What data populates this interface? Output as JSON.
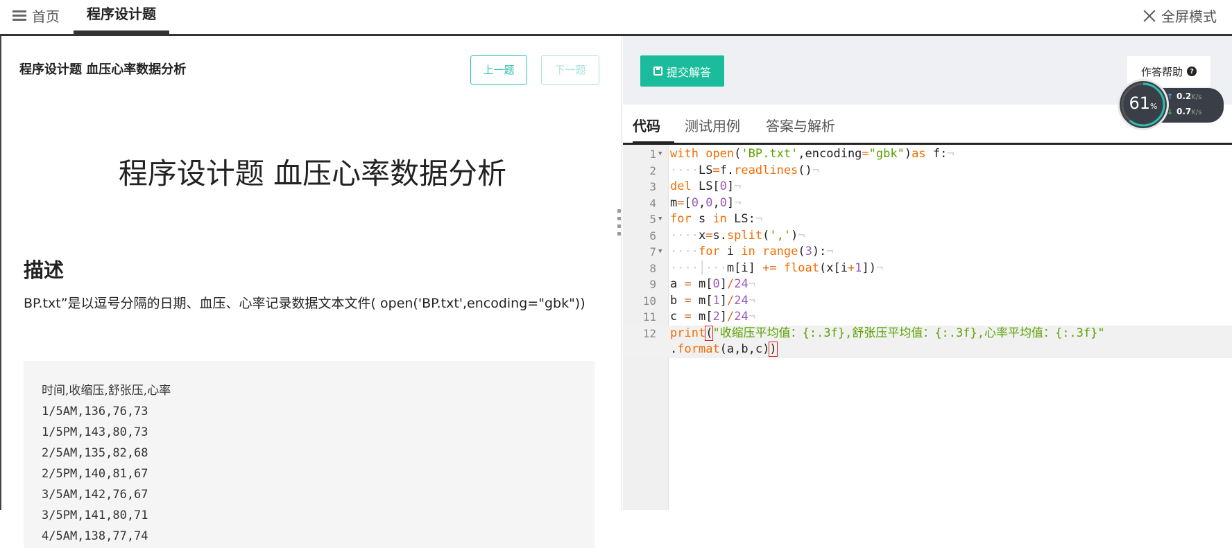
{
  "topbar": {
    "home_label": "首页",
    "tab_label": "程序设计题",
    "fullscreen_label": "全屏模式"
  },
  "question": {
    "header": "程序设计题 血压心率数据分析",
    "prev_label": "上一题",
    "next_label": "下一题",
    "title": "程序设计题 血压心率数据分析",
    "section_heading": "描述",
    "description": "BP.txt”是以逗号分隔的日期、血压、心率记录数据文本文件( open('BP.txt',encoding=\"gbk\"))",
    "data_lines": [
      "时间,收缩压,舒张压,心率",
      "1/5AM,136,76,73",
      "1/5PM,143,80,73",
      "2/5AM,135,82,68",
      "2/5PM,140,81,67",
      "3/5AM,142,76,67",
      "3/5PM,141,80,71",
      "4/5AM,138,77,74"
    ]
  },
  "editor": {
    "submit_label": "提交解答",
    "help_label": "作答帮助",
    "tabs": [
      "代码",
      "测试用例",
      "答案与解析"
    ],
    "line_numbers": [
      "1",
      "2",
      "3",
      "4",
      "5",
      "6",
      "7",
      "8",
      "9",
      "10",
      "11",
      "12"
    ]
  },
  "net_widget": {
    "percent": "61",
    "percent_unit": "%",
    "upload": "0.2",
    "download": "0.7",
    "unit": "K/s"
  },
  "colors": {
    "accent": "#1bbc9b",
    "accent_light": "#a8e3dc",
    "keyword": "#f46c00",
    "string": "#5ba200",
    "number": "#9b59b6"
  }
}
